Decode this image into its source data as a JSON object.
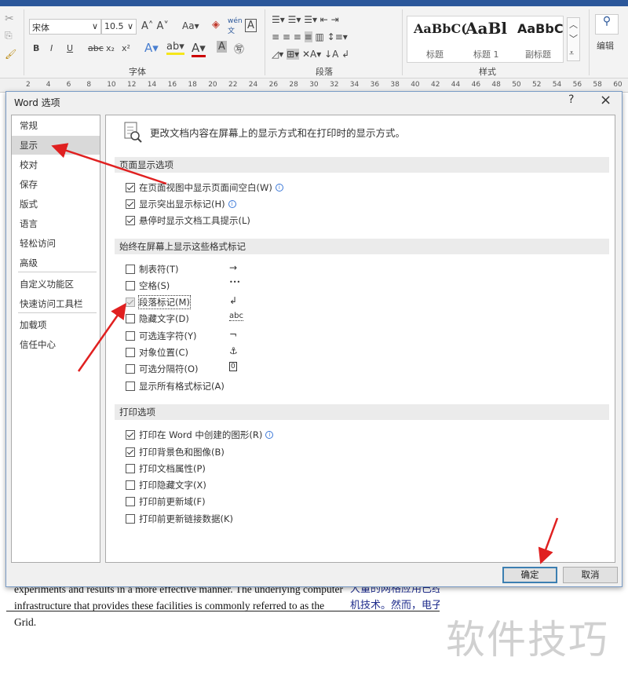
{
  "ribbon": {
    "font_name": "宋体",
    "font_size": "10.5",
    "font_group": "字体",
    "para_group": "段落",
    "styles_group": "样式",
    "styles": [
      {
        "preview": "AaBbC(",
        "label": "标题"
      },
      {
        "preview": "AaBl",
        "label": "标题 1"
      },
      {
        "preview": "AaBbC",
        "label": "副标题"
      }
    ],
    "edit_label": "编辑",
    "font_buttons": [
      "B",
      "I",
      "U",
      "abc",
      "x₂",
      "x²"
    ]
  },
  "ruler": {
    "ticks": [
      "2",
      "4",
      "6",
      "8",
      "10",
      "12",
      "14",
      "16",
      "18",
      "20",
      "22",
      "24",
      "26",
      "28",
      "30",
      "32",
      "34",
      "36",
      "38",
      "40",
      "42",
      "44",
      "46",
      "48",
      "50",
      "52",
      "54",
      "56",
      "58",
      "60"
    ]
  },
  "dialog": {
    "title": "Word 选项",
    "help": "?",
    "close": "×",
    "nav": [
      {
        "label": "常规"
      },
      {
        "label": "显示",
        "selected": true
      },
      {
        "label": "校对"
      },
      {
        "label": "保存"
      },
      {
        "label": "版式"
      },
      {
        "label": "语言"
      },
      {
        "label": "轻松访问"
      },
      {
        "label": "高级"
      },
      {
        "label": "自定义功能区"
      },
      {
        "label": "快速访问工具栏"
      },
      {
        "label": "加载项"
      },
      {
        "label": "信任中心"
      }
    ],
    "header_text": "更改文档内容在屏幕上的显示方式和在打印时的显示方式。",
    "sections": [
      {
        "title": "页面显示选项",
        "options": [
          {
            "label": "在页面视图中显示页面间空白(W)",
            "checked": true,
            "info": true
          },
          {
            "label": "显示突出显示标记(H)",
            "checked": true,
            "info": true
          },
          {
            "label": "悬停时显示文档工具提示(L)",
            "checked": true
          }
        ]
      },
      {
        "title": "始终在屏幕上显示这些格式标记",
        "options": [
          {
            "label": "制表符(T)",
            "checked": false,
            "mark": "→"
          },
          {
            "label": "空格(S)",
            "checked": false,
            "mark": "•••"
          },
          {
            "label": "段落标记(M)",
            "checked": true,
            "disabled": true,
            "mark": "↲"
          },
          {
            "label": "隐藏文字(D)",
            "checked": false,
            "mark": "abc"
          },
          {
            "label": "可选连字符(Y)",
            "checked": false,
            "mark": "¬"
          },
          {
            "label": "对象位置(C)",
            "checked": false,
            "mark": "⚓"
          },
          {
            "label": "可选分隔符(O)",
            "checked": false,
            "mark": "0"
          },
          {
            "label": "显示所有格式标记(A)",
            "checked": false
          }
        ]
      },
      {
        "title": "打印选项",
        "options": [
          {
            "label": "打印在 Word 中创建的图形(R)",
            "checked": true,
            "info": true
          },
          {
            "label": "打印背景色和图像(B)",
            "checked": true
          },
          {
            "label": "打印文档属性(P)",
            "checked": false
          },
          {
            "label": "打印隐藏文字(X)",
            "checked": false
          },
          {
            "label": "打印前更新域(F)",
            "checked": false
          },
          {
            "label": "打印前更新链接数据(K)",
            "checked": false
          }
        ]
      }
    ],
    "ok": "确定",
    "cancel": "取消"
  },
  "document": {
    "en_lines": [
      "experiments and results in a more effective manner. The underlying computer",
      "infrastructure that provides these facilities is commonly referred to as the Grid."
    ],
    "cn_lines": [
      "大量的网格应用已经",
      "机技术。然而，电子"
    ]
  },
  "watermark": "软件技巧",
  "colors": {
    "accent": "#2b579a",
    "arrow": "#e02020"
  }
}
